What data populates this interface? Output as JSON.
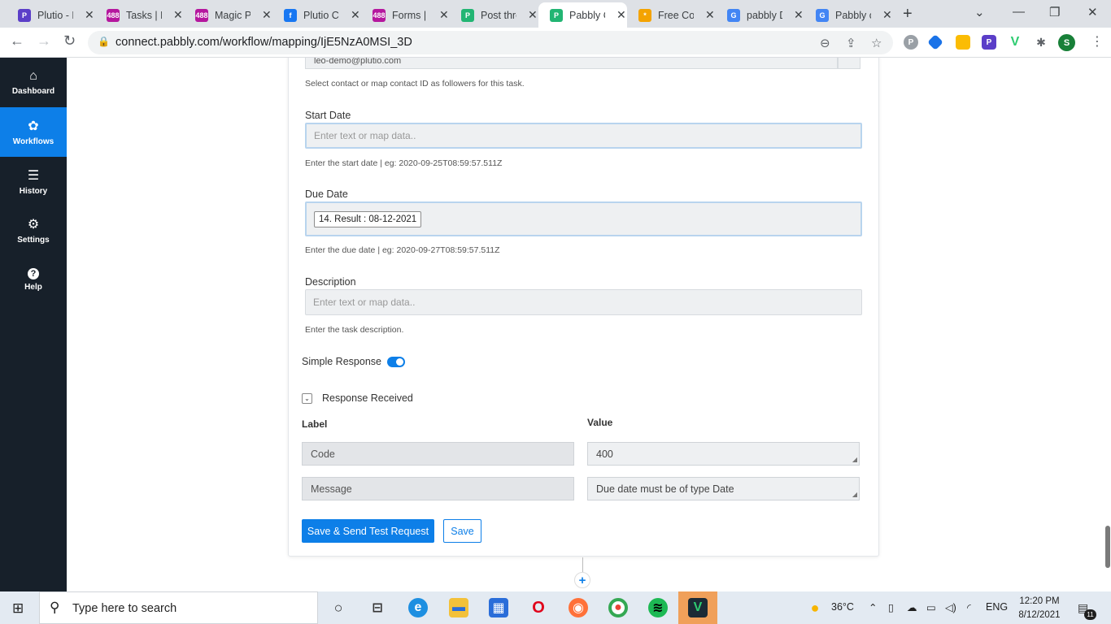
{
  "browser": {
    "tabs": [
      {
        "label": "Plutio - E",
        "color": "#5b3ec8",
        "glyph": "P"
      },
      {
        "label": "Tasks | K",
        "color": "#b5179e",
        "glyph": "488"
      },
      {
        "label": "Magic P",
        "color": "#b5179e",
        "glyph": "488"
      },
      {
        "label": "Plutio C",
        "color": "#1877f2",
        "glyph": "f"
      },
      {
        "label": "Forms | ",
        "color": "#b5179e",
        "glyph": "488"
      },
      {
        "label": "Post thre",
        "color": "#22b573",
        "glyph": "P"
      },
      {
        "label": "Pabbly C",
        "color": "#22b573",
        "glyph": "P"
      },
      {
        "label": "Free Cou",
        "color": "#f4a300",
        "glyph": "*"
      },
      {
        "label": "pabbly D",
        "color": "#4285f4",
        "glyph": "G"
      },
      {
        "label": "Pabbly c",
        "color": "#4285f4",
        "glyph": "G"
      }
    ],
    "active_tab": 6,
    "url": "connect.pabbly.com/workflow/mapping/IjE5NzA0MSI_3D",
    "profile_initial": "S"
  },
  "sidebar": {
    "items": [
      {
        "label": "Dashboard",
        "icon": "home-icon",
        "glyph": "⌂"
      },
      {
        "label": "Workflows",
        "icon": "workflow-icon",
        "glyph": "⚙"
      },
      {
        "label": "History",
        "icon": "history-icon",
        "glyph": "☰"
      },
      {
        "label": "Settings",
        "icon": "gear-icon",
        "glyph": "⚙"
      },
      {
        "label": "Help",
        "icon": "help-icon",
        "glyph": "?"
      }
    ],
    "active": 1
  },
  "form": {
    "followers_value": "leo-demo@plutio.com",
    "followers_help": "Select contact or map contact ID as followers for this task.",
    "start_date": {
      "label": "Start Date",
      "placeholder": "Enter text or map data..",
      "help": "Enter the start date | eg: 2020-09-25T08:59:57.511Z"
    },
    "due_date": {
      "label": "Due Date",
      "chip": "14. Result : 08-12-2021",
      "help": "Enter the due date | eg: 2020-09-27T08:59:57.511Z"
    },
    "description": {
      "label": "Description",
      "placeholder": "Enter text or map data..",
      "help": "Enter the task description."
    },
    "simple_response_label": "Simple Response",
    "simple_response_on": true,
    "response_received_label": "Response Received"
  },
  "response_table": {
    "label_header": "Label",
    "value_header": "Value",
    "rows": [
      {
        "label": "Code",
        "value": "400"
      },
      {
        "label": "Message",
        "value": "Due date must be of type Date"
      }
    ]
  },
  "buttons": {
    "save_send": "Save & Send Test Request",
    "save": "Save"
  },
  "taskbar": {
    "search_placeholder": "Type here to search",
    "temperature": "36°C",
    "language": "ENG",
    "time": "12:20 PM",
    "date": "8/12/2021",
    "notifications": "11"
  }
}
